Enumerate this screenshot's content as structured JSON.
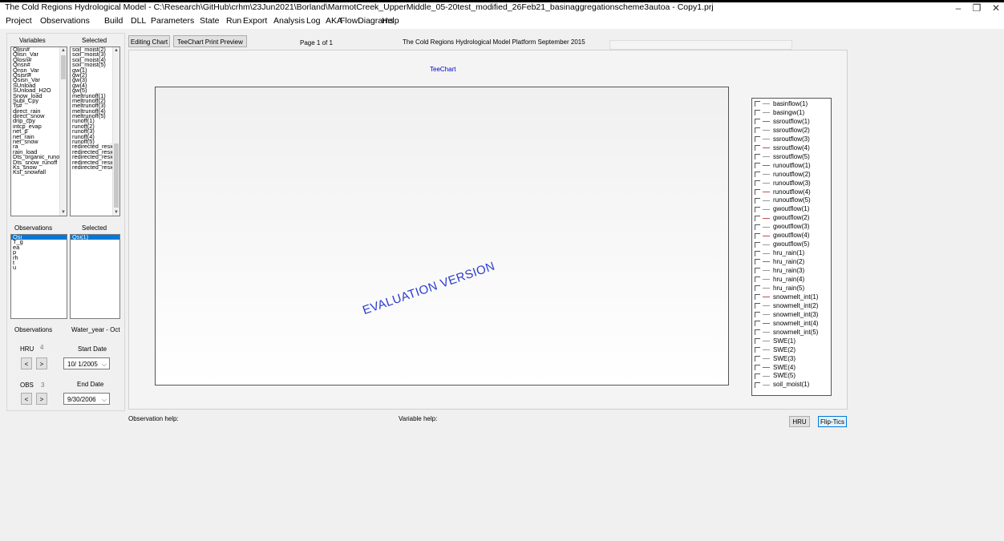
{
  "window": {
    "title": "The Cold Regions Hydrological Model - C:\\Research\\GitHub\\crhm\\23Jun2021\\Borland\\MarmotCreek_UpperMiddle_05-20test_modified_26Feb21_basinaggregationscheme3autoa - Copy1.prj",
    "minimize": "–",
    "restore": "❐",
    "close": "✕"
  },
  "menu": [
    "Project",
    "Observations",
    "Build",
    "DLL",
    "Parameters",
    "State",
    "Run",
    "Export",
    "Analysis",
    "Log",
    "AKA",
    "FlowDiagrams",
    "Help"
  ],
  "variables": {
    "header": "Variables",
    "items": [
      "Qlisn#",
      "Qlisn_Var",
      "Qlosn#",
      "Qnsn#",
      "Qnsn_Var",
      "Qsisn#",
      "Qsisn_Var",
      "SUnload",
      "SUnload_H2O",
      "Snow_load",
      "Subl_Cpy",
      "Ts#",
      "direct_rain",
      "direct_snow",
      "drip_cpy",
      "intcp_evap",
      "net_p",
      "net_rain",
      "net_snow",
      "ra",
      "rain_load",
      "Dts_organic_runo",
      "Dts_snow_runoff",
      "Ks_snow",
      "Ksl_snowfall"
    ]
  },
  "selected_vars": {
    "header": "Selected",
    "items": [
      "soil_moist(2)",
      "soil_moist(3)",
      "soil_moist(4)",
      "soil_moist(5)",
      "gw(1)",
      "gw(2)",
      "gw(3)",
      "gw(4)",
      "gw(5)",
      "meltrunoff(1)",
      "meltrunoff(2)",
      "meltrunoff(3)",
      "meltrunoff(4)",
      "meltrunoff(5)",
      "runoff(1)",
      "runoff(2)",
      "runoff(3)",
      "runoff(4)",
      "runoff(5)",
      "redirected_resic",
      "redirected_resic",
      "redirected_resic",
      "redirected_resic",
      "redirected_resic"
    ]
  },
  "observations": {
    "header": "Observations",
    "items": [
      "Qsi",
      "T_g",
      "ea",
      "p",
      "rh",
      "t",
      "u"
    ],
    "selected_index": 0
  },
  "selected_obs": {
    "header": "Selected",
    "items": [
      "Qsi(1)"
    ],
    "selected_index": 0
  },
  "controls": {
    "observations_label": "Observations",
    "water_year_label": "Water_year - Oct",
    "hru_label": "HRU",
    "hru_value": "4",
    "start_date_label": "Start Date",
    "start_date": "10/ 1/2005",
    "obs_label": "OBS",
    "obs_value": "3",
    "end_date_label": "End Date",
    "end_date": "9/30/2006",
    "prev": "<",
    "next": ">"
  },
  "toolbar": {
    "editing_chart": "Editing Chart",
    "print_preview": "TeeChart Print Preview",
    "page": "Page 1 of 1",
    "platform": "The Cold Regions Hydrological Model Platform September 2015"
  },
  "chart": {
    "title": "TeeChart",
    "watermark": "EVALUATION VERSION",
    "legend": [
      {
        "label": "basinflow(1)",
        "color": "#999999"
      },
      {
        "label": "basingw(1)",
        "color": "#999999"
      },
      {
        "label": "ssroutflow(1)",
        "color": "#c05050"
      },
      {
        "label": "ssroutflow(2)",
        "color": "#999999"
      },
      {
        "label": "ssroutflow(3)",
        "color": "#999999"
      },
      {
        "label": "ssroutflow(4)",
        "color": "#c05050"
      },
      {
        "label": "ssroutflow(5)",
        "color": "#999999"
      },
      {
        "label": "runoutflow(1)",
        "color": "#c05050"
      },
      {
        "label": "runoutflow(2)",
        "color": "#999999"
      },
      {
        "label": "runoutflow(3)",
        "color": "#999999"
      },
      {
        "label": "runoutflow(4)",
        "color": "#c05050"
      },
      {
        "label": "runoutflow(5)",
        "color": "#999999"
      },
      {
        "label": "gwoutflow(1)",
        "color": "#999999"
      },
      {
        "label": "gwoutflow(2)",
        "color": "#c05050"
      },
      {
        "label": "gwoutflow(3)",
        "color": "#999999"
      },
      {
        "label": "gwoutflow(4)",
        "color": "#c05050"
      },
      {
        "label": "gwoutflow(5)",
        "color": "#999999"
      },
      {
        "label": "hru_rain(1)",
        "color": "#999999"
      },
      {
        "label": "hru_rain(2)",
        "color": "#c05050"
      },
      {
        "label": "hru_rain(3)",
        "color": "#999999"
      },
      {
        "label": "hru_rain(4)",
        "color": "#999999"
      },
      {
        "label": "hru_rain(5)",
        "color": "#999999"
      },
      {
        "label": "snowmelt_int(1)",
        "color": "#c05050"
      },
      {
        "label": "snowmelt_int(2)",
        "color": "#999999"
      },
      {
        "label": "snowmelt_int(3)",
        "color": "#999999"
      },
      {
        "label": "snowmelt_int(4)",
        "color": "#c05050"
      },
      {
        "label": "snowmelt_int(5)",
        "color": "#999999"
      },
      {
        "label": "SWE(1)",
        "color": "#999999"
      },
      {
        "label": "SWE(2)",
        "color": "#999999"
      },
      {
        "label": "SWE(3)",
        "color": "#999999"
      },
      {
        "label": "SWE(4)",
        "color": "#c05050"
      },
      {
        "label": "SWE(5)",
        "color": "#999999"
      },
      {
        "label": "soil_moist(1)",
        "color": "#999999"
      }
    ]
  },
  "footer": {
    "observation_help": "Observation help:",
    "variable_help": "Variable help:",
    "hru_button": "HRU",
    "flip_tics_button": "Flip-Tics"
  }
}
